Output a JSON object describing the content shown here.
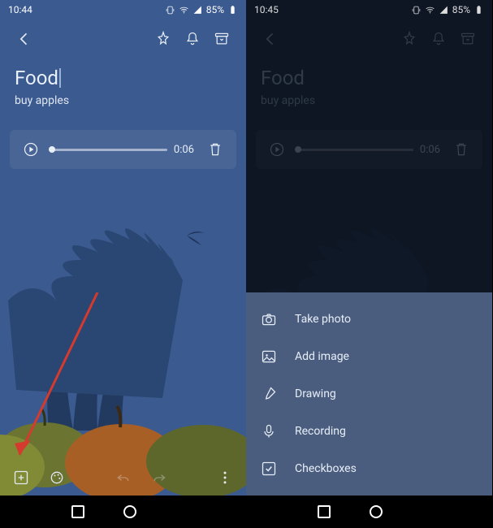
{
  "left": {
    "status": {
      "time": "10:44",
      "battery": "85%"
    },
    "note": {
      "title": "Food",
      "body": "buy apples"
    },
    "audio": {
      "duration": "0:06"
    }
  },
  "right": {
    "status": {
      "time": "10:45",
      "battery": "85%"
    },
    "note": {
      "title": "Food",
      "body": "buy apples"
    },
    "audio": {
      "duration": "0:06"
    },
    "menu": {
      "take_photo": "Take photo",
      "add_image": "Add image",
      "drawing": "Drawing",
      "recording": "Recording",
      "checkboxes": "Checkboxes"
    }
  }
}
